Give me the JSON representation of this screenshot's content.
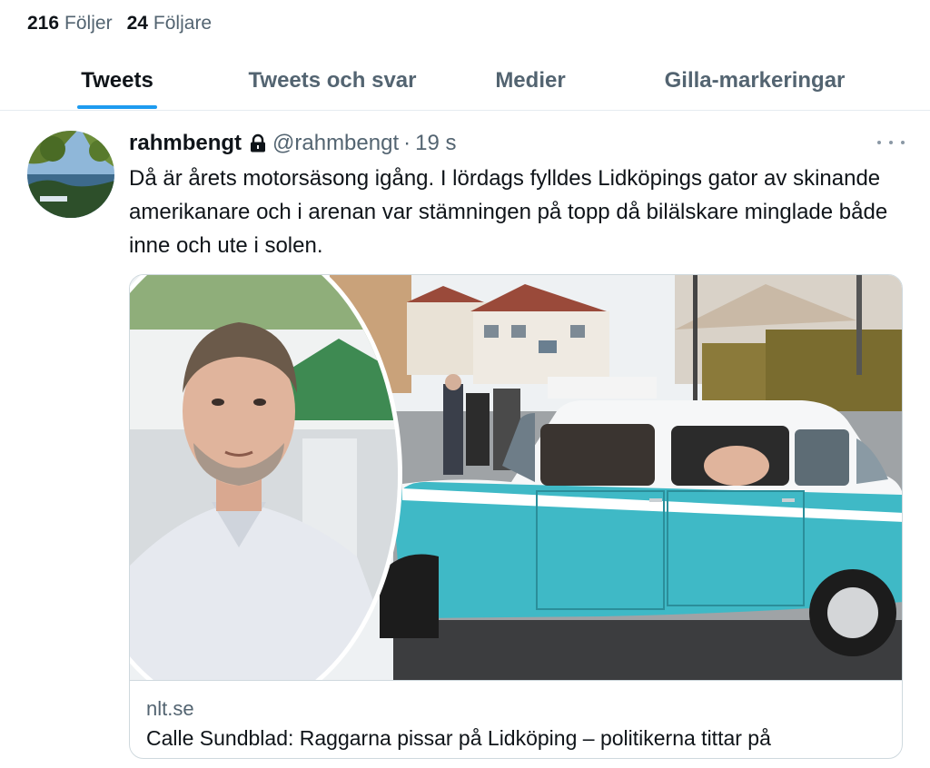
{
  "profile": {
    "following_count": "216",
    "following_label": "Följer",
    "followers_count": "24",
    "followers_label": "Följare"
  },
  "tabs": [
    {
      "label": "Tweets",
      "active": true
    },
    {
      "label": "Tweets och svar",
      "active": false
    },
    {
      "label": "Medier",
      "active": false
    },
    {
      "label": "Gilla-markeringar",
      "active": false
    }
  ],
  "tweet": {
    "display_name": "rahmbengt",
    "protected_icon": "lock-icon",
    "handle": "@rahmbengt",
    "separator": "·",
    "time": "19 s",
    "more_icon": "more-icon",
    "text": "Då är årets motorsäsong igång. I lördags fylldes Lidköpings gator av skinande amerikanare och i arenan var stämningen på topp då bilälskare minglade både inne och ute i solen.",
    "card": {
      "domain": "nlt.se",
      "title": "Calle Sundblad: Raggarna pissar på Lidköping – politikerna tittar på"
    }
  },
  "colors": {
    "accent": "#1d9bf0",
    "text_primary": "#0f1419",
    "text_secondary": "#536471",
    "border": "#cfd9de",
    "car_turquoise": "#3fb9c6"
  }
}
